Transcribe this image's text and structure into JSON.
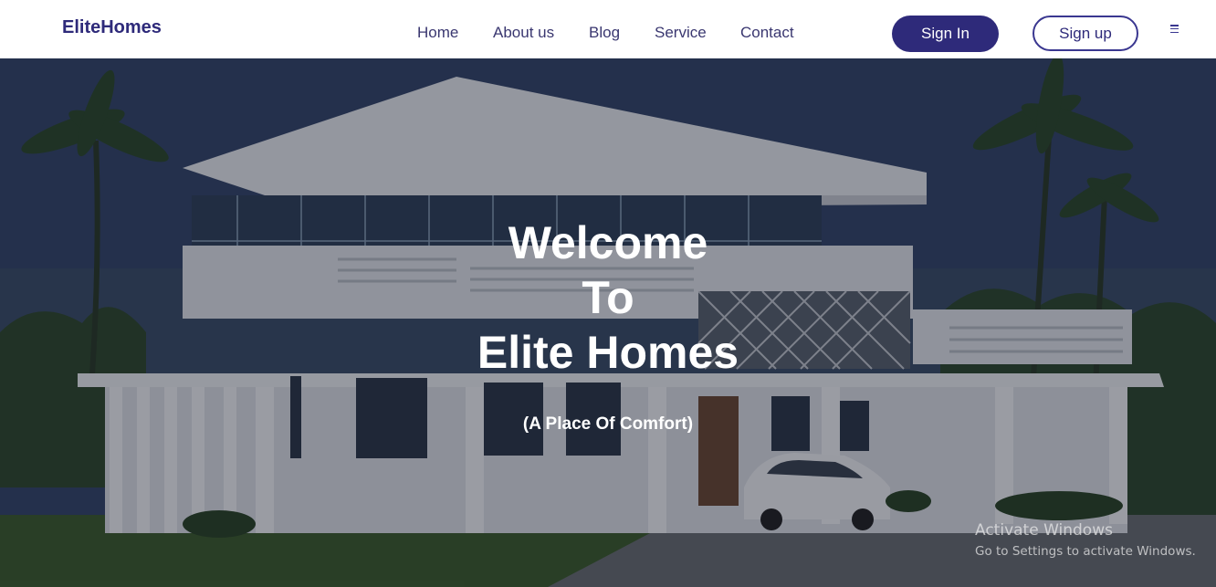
{
  "brand": {
    "logo_text": "EliteHomes"
  },
  "nav": {
    "items": [
      {
        "label": "Home"
      },
      {
        "label": "About us"
      },
      {
        "label": "Blog"
      },
      {
        "label": "Service"
      },
      {
        "label": "Contact"
      }
    ],
    "signin_label": "Sign In",
    "signup_label": "Sign up",
    "menu_icon": "hamburger-menu-icon"
  },
  "hero": {
    "title_line1": "Welcome",
    "title_line2": "To",
    "title_line3": "Elite Homes",
    "subtitle": "(A Place Of Comfort)",
    "image_subject": "modern white villa with palm trees"
  },
  "watermark": {
    "line1": "Activate Windows",
    "line2": "Go to Settings to activate Windows."
  },
  "colors": {
    "brand": "#2e2a7a",
    "nav_text": "#3a3770",
    "hero_text": "#ffffff"
  }
}
